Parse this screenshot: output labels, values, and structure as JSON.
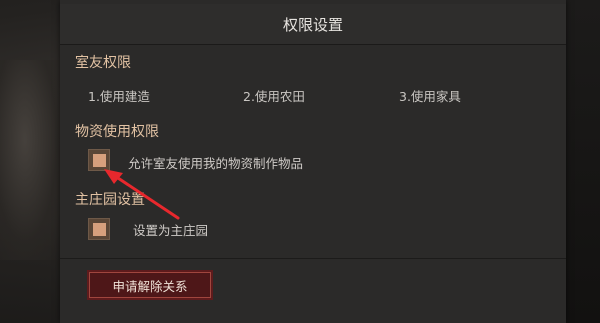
{
  "dialog": {
    "title": "权限设置"
  },
  "roommate_section": {
    "title": "室友权限",
    "permissions": [
      {
        "label": "1.使用建造"
      },
      {
        "label": "2.使用农田"
      },
      {
        "label": "3.使用家具"
      }
    ]
  },
  "materials_section": {
    "title": "物资使用权限",
    "checkbox_label": "允许室友使用我的物资制作物品",
    "checked": true
  },
  "estate_section": {
    "title": "主庄园设置",
    "checkbox_label": "设置为主庄园",
    "checked": true
  },
  "actions": {
    "dissolve_label": "申请解除关系"
  },
  "annotation": {
    "arrow_color": "#e8282d",
    "icon": "red-arrow-icon"
  },
  "colors": {
    "section_title": "#e2c2a3",
    "checkbox_fill": "#d7a07d",
    "button_bg": "#5e1b1c"
  }
}
